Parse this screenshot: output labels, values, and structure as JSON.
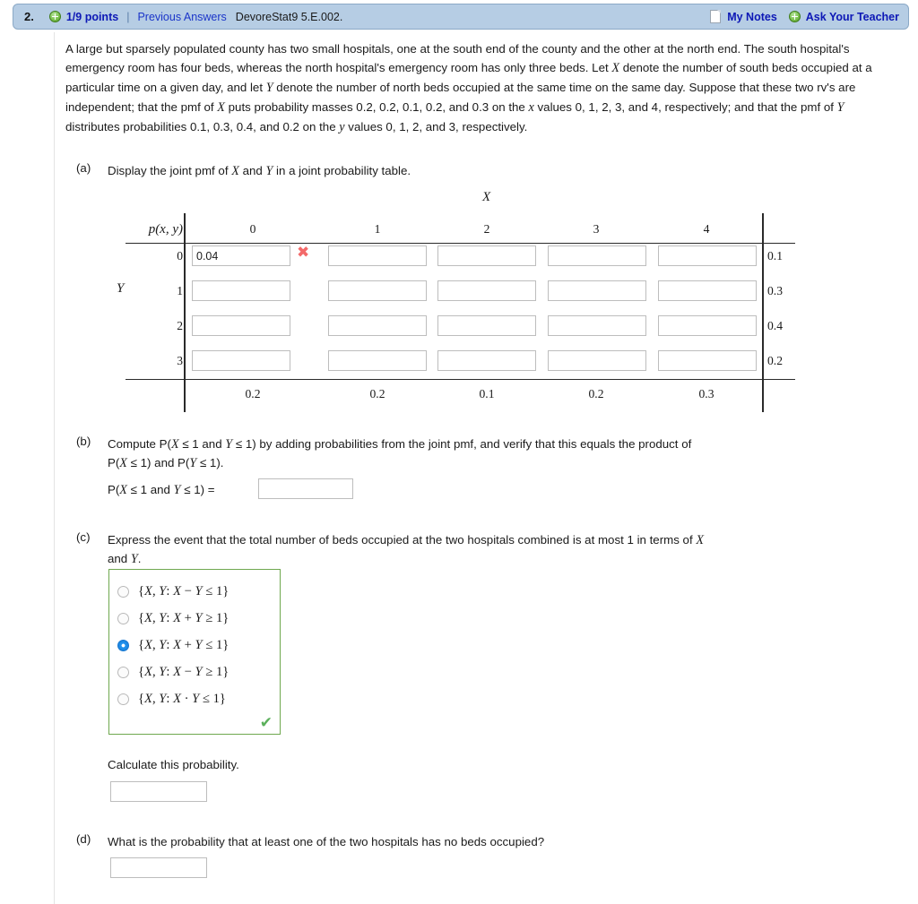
{
  "header": {
    "question_number": "2.",
    "points": "1/9 points",
    "separator": "|",
    "previous_answers": "Previous Answers",
    "question_code": "DevoreStat9 5.E.002.",
    "my_notes": "My Notes",
    "ask_your_teacher": "Ask Your Teacher",
    "plus_icon": "plus-circle-icon",
    "note_icon": "note-page-icon",
    "bar_color": "#b6cde4",
    "link_color": "#0d18b6"
  },
  "stem": {
    "text": "A large but sparsely populated county has two small hospitals, one at the south end of the county and the other at the north end. The south hospital's emergency room has four beds, whereas the north hospital's emergency room has only three beds. Let X denote the number of south beds occupied at a particular time on a given day, and let Y denote the number of north beds occupied at the same time on the same day. Suppose that these two rv's are independent; that the pmf of X puts probability masses 0.2, 0.2, 0.1, 0.2, and 0.3 on the x values 0, 1, 2, 3, and 4, respectively; and that the pmf of Y distributes probabilities 0.1, 0.3, 0.4, and 0.2 on the y values 0, 1, 2, and 3, respectively."
  },
  "parts": {
    "a": {
      "label": "(a)",
      "prompt": "Display the joint pmf of X and Y in a joint probability table."
    },
    "b": {
      "label": "(b)",
      "prompt_line1": "Compute P(X ≤ 1 and Y ≤ 1) by adding probabilities from the joint pmf, and verify that this equals the product of",
      "prompt_line2": "P(X ≤ 1) and P(Y ≤ 1).",
      "answer_label": "P(X ≤ 1 and Y ≤ 1) =",
      "answer_value": ""
    },
    "c": {
      "label": "(c)",
      "prompt_line1": "Express the event that the total number of beds occupied at the two hospitals combined is at most 1 in terms of X",
      "prompt_line2": "and Y.",
      "options": [
        {
          "text": "{X, Y: X − Y ≤ 1}",
          "selected": false
        },
        {
          "text": "{X, Y: X + Y ≥ 1}",
          "selected": false
        },
        {
          "text": "{X, Y: X + Y ≤ 1}",
          "selected": true
        },
        {
          "text": "{X, Y: X − Y ≥ 1}",
          "selected": false
        },
        {
          "text": "{X, Y: X · Y ≤ 1}",
          "selected": false
        }
      ],
      "correct_mark": "✔",
      "correct_mark_color": "#5bb05b",
      "sub_prompt": "Calculate this probability.",
      "sub_answer_value": ""
    },
    "d": {
      "label": "(d)",
      "prompt": "What is the probability that at least one of the two hospitals has no beds occupied?",
      "answer_value": ""
    }
  },
  "joint_table": {
    "x_axis_label": "X",
    "y_axis_label": "Y",
    "corner_label": "p(x, y)",
    "column_headers": [
      "0",
      "1",
      "2",
      "3",
      "4"
    ],
    "row_headers": [
      "0",
      "1",
      "2",
      "3"
    ],
    "cells": [
      [
        "0.04",
        "",
        "",
        "",
        ""
      ],
      [
        "",
        "",
        "",
        "",
        ""
      ],
      [
        "",
        "",
        "",
        "",
        ""
      ],
      [
        "",
        "",
        "",
        "",
        ""
      ]
    ],
    "cell_marks": [
      [
        "wrong",
        "",
        "",
        "",
        ""
      ],
      [
        "",
        "",
        "",
        "",
        ""
      ],
      [
        "",
        "",
        "",
        "",
        ""
      ],
      [
        "",
        "",
        "",
        "",
        ""
      ]
    ],
    "wrong_mark_glyph": "✖",
    "wrong_mark_color": "#f36a6a",
    "row_margins": [
      "0.1",
      "0.3",
      "0.4",
      "0.2"
    ],
    "column_margins": [
      "0.2",
      "0.2",
      "0.1",
      "0.2",
      "0.3"
    ]
  }
}
